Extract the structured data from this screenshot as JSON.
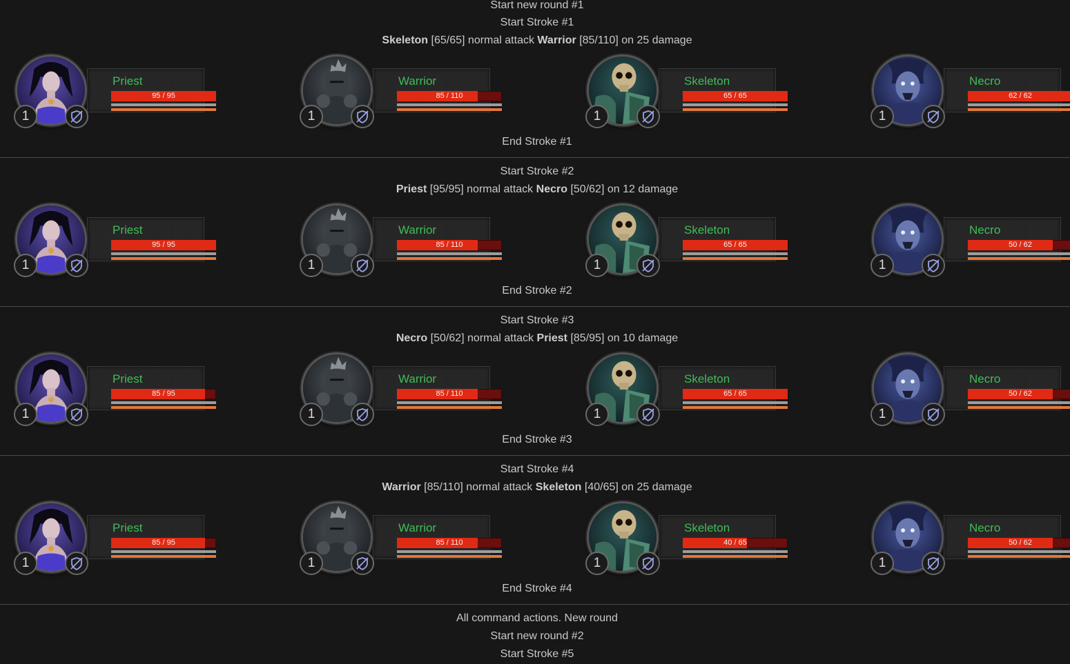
{
  "log": {
    "l0": {
      "text": "Start new round #1"
    },
    "s1": {
      "start": "Start Stroke #1",
      "attacker": "Skeleton",
      "attacker_hp": "[65/65]",
      "action": "normal attack",
      "target": "Warrior",
      "target_hp": "[85/110]",
      "outcome": "on 25 damage",
      "end": "End Stroke #1"
    },
    "s2": {
      "start": "Start Stroke #2",
      "attacker": "Priest",
      "attacker_hp": "[95/95]",
      "action": "normal attack",
      "target": "Necro",
      "target_hp": "[50/62]",
      "outcome": "on 12 damage",
      "end": "End Stroke #2"
    },
    "s3": {
      "start": "Start Stroke #3",
      "attacker": "Necro",
      "attacker_hp": "[50/62]",
      "action": "normal attack",
      "target": "Priest",
      "target_hp": "[85/95]",
      "outcome": "on 10 damage",
      "end": "End Stroke #3"
    },
    "s4": {
      "start": "Start Stroke #4",
      "attacker": "Warrior",
      "attacker_hp": "[85/110]",
      "action": "normal attack",
      "target": "Skeleton",
      "target_hp": "[40/65]",
      "outcome": "on 25 damage",
      "end": "End Stroke #4"
    },
    "tail": {
      "all": "All command actions. New round",
      "round2": "Start new round #2",
      "stroke5": "Start Stroke #5"
    }
  },
  "rows": [
    {
      "priest": {
        "name": "Priest",
        "hp": "95 / 95",
        "hp_fraction": 1.0,
        "level": "1"
      },
      "warrior": {
        "name": "Warrior",
        "hp": "85 / 110",
        "hp_fraction": 0.773,
        "level": "1"
      },
      "skeleton": {
        "name": "Skeleton",
        "hp": "65 / 65",
        "hp_fraction": 1.0,
        "level": "1"
      },
      "necro": {
        "name": "Necro",
        "hp": "62 / 62",
        "hp_fraction": 1.0,
        "level": "1"
      }
    },
    {
      "priest": {
        "name": "Priest",
        "hp": "95 / 95",
        "hp_fraction": 1.0,
        "level": "1"
      },
      "warrior": {
        "name": "Warrior",
        "hp": "85 / 110",
        "hp_fraction": 0.773,
        "level": "1"
      },
      "skeleton": {
        "name": "Skeleton",
        "hp": "65 / 65",
        "hp_fraction": 1.0,
        "level": "1"
      },
      "necro": {
        "name": "Necro",
        "hp": "50 / 62",
        "hp_fraction": 0.806,
        "level": "1"
      }
    },
    {
      "priest": {
        "name": "Priest",
        "hp": "85 / 95",
        "hp_fraction": 0.895,
        "level": "1"
      },
      "warrior": {
        "name": "Warrior",
        "hp": "85 / 110",
        "hp_fraction": 0.773,
        "level": "1"
      },
      "skeleton": {
        "name": "Skeleton",
        "hp": "65 / 65",
        "hp_fraction": 1.0,
        "level": "1"
      },
      "necro": {
        "name": "Necro",
        "hp": "50 / 62",
        "hp_fraction": 0.806,
        "level": "1"
      }
    },
    {
      "priest": {
        "name": "Priest",
        "hp": "85 / 95",
        "hp_fraction": 0.895,
        "level": "1"
      },
      "warrior": {
        "name": "Warrior",
        "hp": "85 / 110",
        "hp_fraction": 0.773,
        "level": "1"
      },
      "skeleton": {
        "name": "Skeleton",
        "hp": "40 / 65",
        "hp_fraction": 0.615,
        "level": "1"
      },
      "necro": {
        "name": "Necro",
        "hp": "50 / 62",
        "hp_fraction": 0.806,
        "level": "1"
      }
    }
  ],
  "icons": {
    "defense": "shield-slash-icon"
  },
  "colors": {
    "name": "#3fbd57",
    "hp_fill": "#e12a14",
    "hp_empty": "#6a0e0e",
    "bar_grey": "#9d9d9d",
    "bar_orange": "#e3783a"
  }
}
